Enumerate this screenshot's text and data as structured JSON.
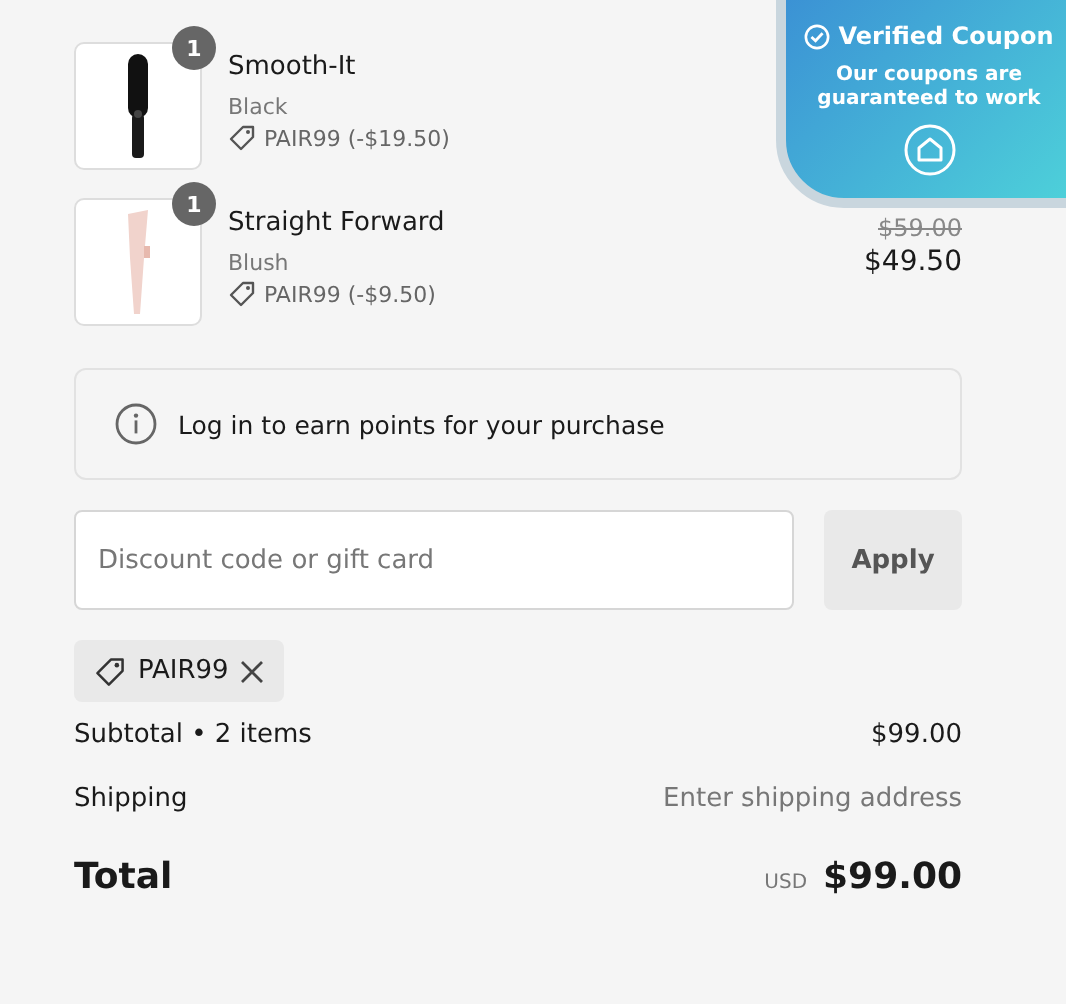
{
  "items": [
    {
      "name": "Smooth-It",
      "variant": "Black",
      "quantity": "1",
      "discount": "PAIR99 (-$19.50)",
      "kind": "brush"
    },
    {
      "name": "Straight Forward",
      "variant": "Blush",
      "quantity": "1",
      "discount": "PAIR99 (-$9.50)",
      "kind": "straightener",
      "original_price": "$59.00",
      "price": "$49.50"
    }
  ],
  "info": {
    "text": "Log in to earn points for your purchase"
  },
  "discount_field": {
    "placeholder": "Discount code or gift card"
  },
  "apply_button": "Apply",
  "applied_code": "PAIR99",
  "summary": [
    {
      "label": "Subtotal • 2 items",
      "value": "$99.00",
      "muted": false
    },
    {
      "label": "Shipping",
      "value": "Enter shipping address",
      "muted": true
    }
  ],
  "total": {
    "label": "Total",
    "currency": "USD",
    "amount": "$99.00"
  },
  "coupon_badge": {
    "title": "Verified Coupon",
    "text": "Our coupons are guaranteed to work"
  }
}
